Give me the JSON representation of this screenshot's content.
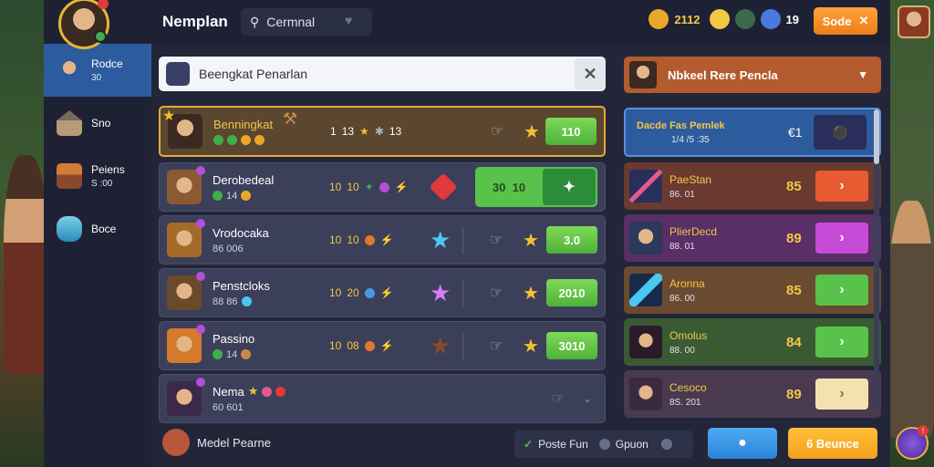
{
  "header": {
    "title": "Nemplan",
    "search_chip": "Cermnal",
    "currencies": [
      {
        "icon": "gold-coin-icon",
        "value": "2112",
        "color": "#f2c844"
      },
      {
        "icon": "star-coin-icon",
        "value": "",
        "color": "#f2c844"
      },
      {
        "icon": "gem-icon",
        "value": "",
        "color": "#3fae4a"
      },
      {
        "icon": "blue-crystal-icon",
        "value": "19",
        "color": "#ffffff"
      }
    ],
    "top_button_label": "Sode",
    "top_button_icon": "close-icon"
  },
  "sidebar": {
    "items": [
      {
        "label": "Rodce",
        "sub": "30"
      },
      {
        "label": "Sno",
        "sub": ""
      },
      {
        "label": "Peiens",
        "sub": "S :00"
      },
      {
        "label": "Boce",
        "sub": ""
      }
    ]
  },
  "main": {
    "search_text": "Beengkat Penarlan",
    "rows": [
      {
        "name": "Benningkat",
        "stats_a": "1",
        "stats_b": "13",
        "stats_c": "13",
        "button": "110",
        "featured": true
      },
      {
        "name": "Derobedeal",
        "sub": "14",
        "stats_a": "10",
        "stats_b": "10",
        "big_left": "30",
        "big_mid": "10",
        "featured": false
      },
      {
        "name": "Vrodocaka",
        "sub": "86 006",
        "stats_a": "10",
        "stats_b": "10",
        "button": "3.0",
        "featured": false
      },
      {
        "name": "Penstcloks",
        "sub": "88 86",
        "stats_a": "10",
        "stats_b": "20",
        "button": "2010",
        "featured": false
      },
      {
        "name": "Passino",
        "sub": "14",
        "stats_a": "10",
        "stats_b": "08",
        "button": "3010",
        "featured": false
      },
      {
        "name": "Nema",
        "sub": "60 601",
        "featured": false
      }
    ]
  },
  "right": {
    "header": "Nbkeel Rere Pencla",
    "selected": {
      "title": "Dacde Fas Pemlek",
      "sub": "1/4 /5 :35",
      "num": "€1"
    },
    "items": [
      {
        "name": "PaeStan",
        "sub": "86. 01",
        "score": "85",
        "bg": "#6a3a30",
        "btn": "#e85a32"
      },
      {
        "name": "PlierDecd",
        "sub": "88. 01",
        "score": "89",
        "bg": "#5a2e66",
        "btn": "#c84ad8"
      },
      {
        "name": "Aronna",
        "sub": "86. 00",
        "score": "85",
        "bg": "#6a4a30",
        "btn": "#58c24a"
      },
      {
        "name": "Omolus",
        "sub": "88. 00",
        "score": "84",
        "bg": "#3a5a34",
        "btn": "#58c24a"
      },
      {
        "name": "Cesoco",
        "sub": "8S. 201",
        "score": "89",
        "bg": "#4a3a50",
        "btn": "#f2e2b0"
      }
    ]
  },
  "footer": {
    "left_label": "Medel Pearne",
    "filter_label": "Poste Fun",
    "filter_option": "Gpuon",
    "orange_button": "6 Beunce"
  }
}
